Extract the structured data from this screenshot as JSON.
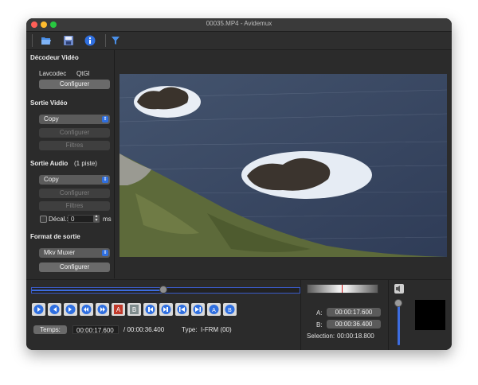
{
  "window": {
    "title": "00035.MP4 - Avidemux"
  },
  "toolbar": {
    "icons": [
      "open-file-icon",
      "save-file-icon",
      "info-icon",
      "filter-icon"
    ]
  },
  "video_decoder": {
    "header": "Décodeur Vidéo",
    "codec": "Lavcodec",
    "renderer": "QtGl",
    "configure_label": "Configurer"
  },
  "video_output": {
    "header": "Sortie Vidéo",
    "codec_value": "Copy",
    "configure_label": "Configurer",
    "filters_label": "Filtres"
  },
  "audio_output": {
    "header": "Sortie Audio",
    "tracks_label": "(1 piste)",
    "codec_value": "Copy",
    "configure_label": "Configurer",
    "filters_label": "Filtres",
    "shift_label": "Décal.:",
    "shift_value": "0",
    "shift_unit": "ms"
  },
  "output_format": {
    "header": "Format de sortie",
    "muxer_value": "Mkv Muxer",
    "configure_label": "Configurer"
  },
  "timeline": {
    "position_fraction": 0.49
  },
  "navigation": {
    "buttons": [
      "play-icon",
      "rewind-icon",
      "forward-icon",
      "previous-keyframe-icon",
      "next-keyframe-icon",
      "set-marker-a-icon",
      "set-marker-b-icon",
      "previous-black-frame-icon",
      "next-black-frame-icon",
      "go-to-start-icon",
      "go-to-end-icon",
      "go-to-marker-a-icon",
      "go-to-marker-b-icon"
    ]
  },
  "time": {
    "temps_label": "Temps:",
    "current": "00:00:17.600",
    "total": "/ 00:00:36.400",
    "type_label": "Type:",
    "type_value": "I-FRM (00)"
  },
  "selection": {
    "a_label": "A:",
    "a_value": "00:00:17.600",
    "b_label": "B:",
    "b_value": "00:00:36.400",
    "selection_label": "Selection:",
    "selection_value": "00:00:18.800"
  },
  "volume": {
    "level_fraction": 0.55
  },
  "colors": {
    "accent": "#3d6de0",
    "window_bg": "#2b2b2b",
    "button": "#6a6a6a"
  }
}
